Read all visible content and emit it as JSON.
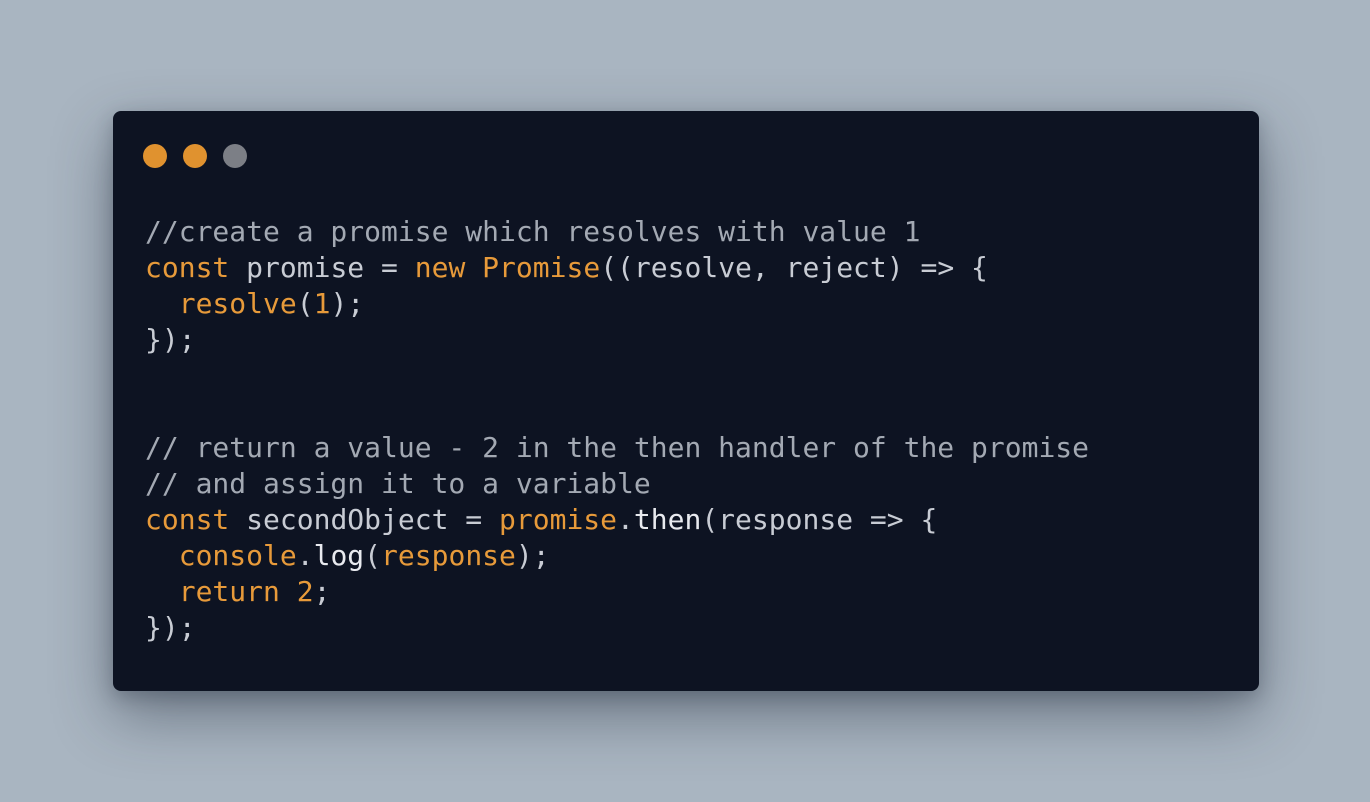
{
  "colors": {
    "background": "#a9b5c1",
    "window": "#0d1322",
    "text": "#c8ccd4",
    "keyword": "#e79a3a",
    "comment": "#a3a9b3"
  },
  "window_controls": [
    {
      "name": "close",
      "color": "#e0922f"
    },
    {
      "name": "minimize",
      "color": "#e0922f"
    },
    {
      "name": "maximize",
      "color": "#7c7f86"
    }
  ],
  "code_lines": [
    [
      {
        "t": "//create a promise which resolves with value 1",
        "c": "#a3a9b3"
      }
    ],
    [
      {
        "t": "const",
        "c": "#e79a3a"
      },
      {
        "t": " promise = ",
        "c": "#c8ccd4"
      },
      {
        "t": "new",
        "c": "#e79a3a"
      },
      {
        "t": " ",
        "c": "#c8ccd4"
      },
      {
        "t": "Promise",
        "c": "#e79a3a"
      },
      {
        "t": "((resolve, reject) => {",
        "c": "#c8ccd4"
      }
    ],
    [
      {
        "t": "  ",
        "c": "#c8ccd4"
      },
      {
        "t": "resolve",
        "c": "#e79a3a"
      },
      {
        "t": "(",
        "c": "#c8ccd4"
      },
      {
        "t": "1",
        "c": "#e79a3a"
      },
      {
        "t": ");",
        "c": "#c8ccd4"
      }
    ],
    [
      {
        "t": "});",
        "c": "#c8ccd4"
      }
    ],
    [],
    [],
    [
      {
        "t": "// return a value - 2 in the then handler of the promise",
        "c": "#a3a9b3"
      }
    ],
    [
      {
        "t": "// and assign it to a variable",
        "c": "#a3a9b3"
      }
    ],
    [
      {
        "t": "const",
        "c": "#e79a3a"
      },
      {
        "t": " secondObject = ",
        "c": "#c8ccd4"
      },
      {
        "t": "promise",
        "c": "#e79a3a"
      },
      {
        "t": ".",
        "c": "#c8ccd4"
      },
      {
        "t": "then",
        "c": "#e8eaef"
      },
      {
        "t": "(response => {",
        "c": "#c8ccd4"
      }
    ],
    [
      {
        "t": "  ",
        "c": "#c8ccd4"
      },
      {
        "t": "console",
        "c": "#e79a3a"
      },
      {
        "t": ".",
        "c": "#c8ccd4"
      },
      {
        "t": "log",
        "c": "#e8eaef"
      },
      {
        "t": "(",
        "c": "#c8ccd4"
      },
      {
        "t": "response",
        "c": "#e79a3a"
      },
      {
        "t": ");",
        "c": "#c8ccd4"
      }
    ],
    [
      {
        "t": "  ",
        "c": "#c8ccd4"
      },
      {
        "t": "return",
        "c": "#e79a3a"
      },
      {
        "t": " ",
        "c": "#c8ccd4"
      },
      {
        "t": "2",
        "c": "#e79a3a"
      },
      {
        "t": ";",
        "c": "#c8ccd4"
      }
    ],
    [
      {
        "t": "});",
        "c": "#c8ccd4"
      }
    ]
  ]
}
